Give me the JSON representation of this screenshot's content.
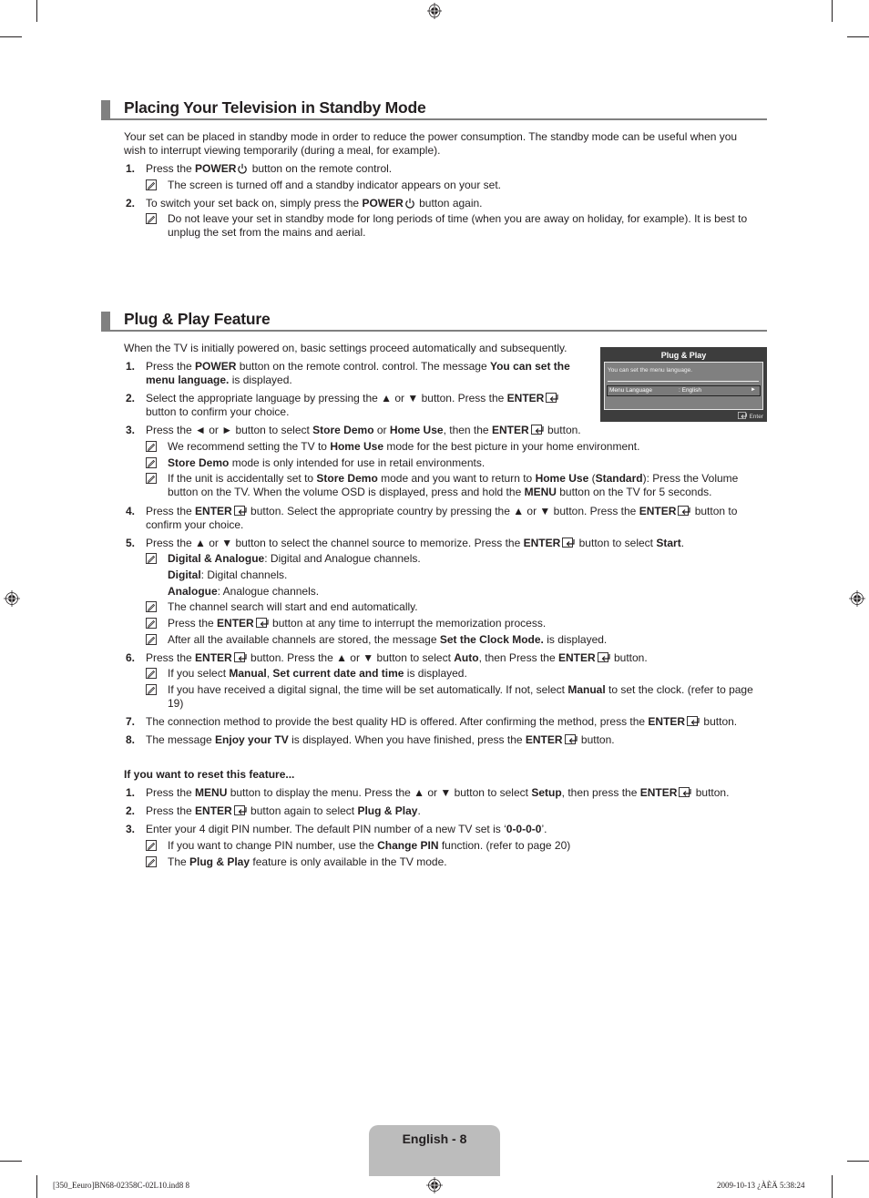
{
  "sections": {
    "standby": {
      "title": "Placing Your Television in Standby Mode",
      "intro_1": "Your set can be placed in standby mode in order to reduce the power consumption. The standby mode can be useful when you",
      "intro_2": "wish to interrupt viewing temporarily (during a meal, for example).",
      "steps": [
        {
          "num": "1.",
          "a": "Press the ",
          "b1": "POWER",
          "c": " button on the remote control.",
          "note": "The screen is turned off and a standby indicator appears on your set."
        },
        {
          "num": "2.",
          "a": "To switch your set back on, simply press the ",
          "b1": "POWER",
          "c": " button again.",
          "note_1": "Do not leave your set in standby mode for long periods of time (when you are away on holiday, for example). It is best to",
          "note_2": "unplug the set from the mains and aerial."
        }
      ]
    },
    "plug_play": {
      "title": "Plug & Play Feature",
      "intro": "When the TV is initially powered on, basic settings proceed automatically and subsequently.",
      "step1": {
        "num": "1.",
        "a": "Press the ",
        "b1": "POWER",
        "c": " button on the remote control. control. The message ",
        "b2": "You can set the",
        "b3": "menu language.",
        "d": " is displayed."
      },
      "step2": {
        "num": "2.",
        "a": "Select the appropriate language by pressing the ▲ or ▼ button. Press the ",
        "b1": "ENTER",
        "line2": "button to confirm your choice."
      },
      "step3": {
        "num": "3.",
        "a": "Press the ◄ or ► button to select ",
        "b1": "Store Demo",
        "c": " or ",
        "b2": "Home Use",
        "d": ", then the ",
        "b3": "ENTER",
        "e": " button.",
        "notes": [
          {
            "a": "We recommend setting the TV to ",
            "b": "Home Use",
            "c": " mode for the best picture in your home environment."
          },
          {
            "b": "Store Demo",
            "c": " mode is only intended for use in retail environments."
          },
          {
            "a": "If the unit is accidentally set to ",
            "b": "Store Demo",
            "c": " mode and you want to return to ",
            "b2": "Home Use",
            "d": " (",
            "b3": "Standard",
            "e": "): Press the Volume",
            "line2a": "button on the TV. When the volume OSD is displayed, press and hold the ",
            "line2b": "MENU",
            "line2c": " button on the TV for 5 seconds."
          }
        ]
      },
      "step4": {
        "num": "4.",
        "a": "Press the ",
        "b1": "ENTER",
        "c": " button. Select the appropriate country by pressing the ▲ or ▼ button. Press the ",
        "b2": "ENTER",
        "d": " button to",
        "line2": "confirm your choice."
      },
      "step5": {
        "num": "5.",
        "a": "Press the ▲ or ▼ button to select the channel source to memorize. Press the ",
        "b1": "ENTER",
        "c": " button to select ",
        "b2": "Start",
        "d": ".",
        "sources": [
          {
            "b": "Digital & Analogue",
            "c": ": Digital and Analogue channels."
          },
          {
            "b": "Digital",
            "c": ": Digital channels."
          },
          {
            "b": "Analogue",
            "c": ": Analogue channels."
          }
        ],
        "notes": [
          {
            "a": "The channel search will start and end automatically."
          },
          {
            "a": "Press the ",
            "b": "ENTER",
            "c": " button at any time to interrupt the memorization process."
          },
          {
            "a": "After all the available channels are stored, the message ",
            "b": "Set the Clock Mode.",
            "c": " is displayed."
          }
        ]
      },
      "step6": {
        "num": "6.",
        "a": "Press the ",
        "b1": "ENTER",
        "c": " button. Press the ▲ or ▼ button to select ",
        "b2": "Auto",
        "d": ", then Press the ",
        "b3": "ENTER",
        "e": " button.",
        "notes": [
          {
            "a": "If you select ",
            "b": "Manual",
            "c": ", ",
            "b2": "Set current date and time",
            "d": " is displayed."
          },
          {
            "a": "If you have received a digital signal, the time will be set automatically. If not, select ",
            "b": "Manual",
            "c": " to set the clock. (refer to page",
            "line2": "19)"
          }
        ]
      },
      "step7": {
        "num": "7.",
        "a": "The connection method to provide the best quality HD is offered. After confirming the method, press the ",
        "b1": "ENTER",
        "c": " button."
      },
      "step8": {
        "num": "8.",
        "a": "The message ",
        "b1": "Enjoy your TV",
        "c": " is displayed. When you have finished, press the ",
        "b2": "ENTER",
        "d": " button."
      },
      "reset": {
        "heading": "If you want to reset this feature...",
        "step1": {
          "num": "1.",
          "a": "Press the ",
          "b1": "MENU",
          "c": " button to display the menu. Press the ▲ or ▼ button to select ",
          "b2": "Setup",
          "d": ", then press the ",
          "b3": "ENTER",
          "e": " button."
        },
        "step2": {
          "num": "2.",
          "a": "Press the ",
          "b1": "ENTER",
          "c": " button again to select ",
          "b2": "Plug & Play",
          "d": "."
        },
        "step3": {
          "num": "3.",
          "a": "Enter your 4 digit PIN number. The default PIN number of a new TV set is ‘",
          "b1": "0-0-0-0",
          "c": "’.",
          "notes": [
            {
              "a": "If you want to change PIN number, use the ",
              "b": "Change PIN",
              "c": " function. (refer to page 20)"
            },
            {
              "a": "The ",
              "b": "Plug & Play",
              "c": " feature is only available in the TV mode."
            }
          ]
        }
      }
    }
  },
  "osd": {
    "title": "Plug & Play",
    "message": "You can set the menu language.",
    "row_label": "Menu Language",
    "row_value": ": English",
    "row_arrow": "►",
    "footer": "Enter"
  },
  "footer": {
    "page_label": "English - 8",
    "slug_left": "[350_Eeuro]BN68-02358C-02L10.ind8   8",
    "slug_right": "2009-10-13   ¿ÀÈÄ 5:38:24"
  }
}
